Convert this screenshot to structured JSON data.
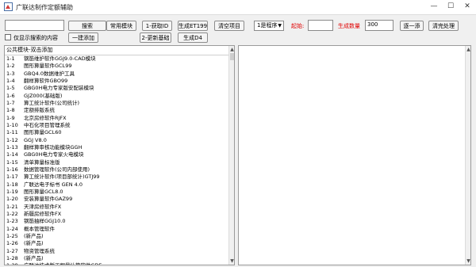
{
  "window": {
    "title": "广联达制作定额辅助",
    "minimize": "—",
    "maximize": "☐",
    "close": "✕"
  },
  "toolbar": {
    "search_input_value": "",
    "search_button": "搜索",
    "common_modules_button": "常用模块",
    "get_id_button": "1-获取ID",
    "generate_et199_button": "生成ET199",
    "clear_items_button": "清空项目",
    "only_show_search_label": "仅显示搜索的内容",
    "one_key_add_button": "一建添加",
    "update_base_button": "2-更新基础",
    "generate_d4_button": "生成D4",
    "program_select_value": "1是程序",
    "start_label": "起始:",
    "start_value": "",
    "generate_count_label": "生成数量",
    "generate_count_value": "300",
    "one_by_one_button": "逐一添",
    "clear_done_button": "清完处理"
  },
  "list": {
    "header": "公共模块-双击添加",
    "rows": [
      {
        "no": "1-1",
        "name": "钢筋维护软件GGJ9.0-CAD模块"
      },
      {
        "no": "1-2",
        "name": "图形算量软件GCL99"
      },
      {
        "no": "1-3",
        "name": "GBQ4.0数据维护工具"
      },
      {
        "no": "1-4",
        "name": "翻样算软件GBO99"
      },
      {
        "no": "1-5",
        "name": "GBG0H电力专家版安配装模块"
      },
      {
        "no": "1-6",
        "name": "GJZ000(基础版)"
      },
      {
        "no": "1-7",
        "name": "算工统计软件(公司统计)"
      },
      {
        "no": "1-8",
        "name": "定额排版系统"
      },
      {
        "no": "1-9",
        "name": "北京房修软件RJFX"
      },
      {
        "no": "1-10",
        "name": "中石化项目管理系统"
      },
      {
        "no": "1-11",
        "name": "图形算量GCL60"
      },
      {
        "no": "1-12",
        "name": "GGJ V8.0"
      },
      {
        "no": "1-13",
        "name": "翻样算审核功能模块GGH"
      },
      {
        "no": "1-14",
        "name": "GBG0H电力专家火电模块"
      },
      {
        "no": "1-15",
        "name": "清单算量标准版"
      },
      {
        "no": "1-16",
        "name": "数据管理软件(公司内部使用)"
      },
      {
        "no": "1-17",
        "name": "算工统计软件(项目部统计)GTJ99"
      },
      {
        "no": "1-18",
        "name": "广联达电子标书 GEN 4.0"
      },
      {
        "no": "1-19",
        "name": "图形算量GCL8.0"
      },
      {
        "no": "1-20",
        "name": "安装算量软件GAZ99"
      },
      {
        "no": "1-21",
        "name": "天津房修软件FX"
      },
      {
        "no": "1-22",
        "name": "新疆房修软件FX"
      },
      {
        "no": "1-23",
        "name": "钢筋抽样GGJ10.0"
      },
      {
        "no": "1-24",
        "name": "概本管理软件"
      },
      {
        "no": "1-25",
        "name": "(新产品)"
      },
      {
        "no": "1-26",
        "name": "(新产品)"
      },
      {
        "no": "1-27",
        "name": "物资管理系统"
      },
      {
        "no": "1-28",
        "name": "(新产品)"
      },
      {
        "no": "1-29",
        "name": "广联达技术版工程量计算软件GDF"
      },
      {
        "no": "1-30",
        "name": "广联达安装版工程量计算软件GDF"
      }
    ]
  },
  "icons": {
    "app": "app-icon",
    "dropdown": "chevron-down-icon",
    "scroll_up": "scroll-up-icon",
    "scroll_down": "scroll-down-icon"
  },
  "colors": {
    "label_red": "#e00000"
  }
}
